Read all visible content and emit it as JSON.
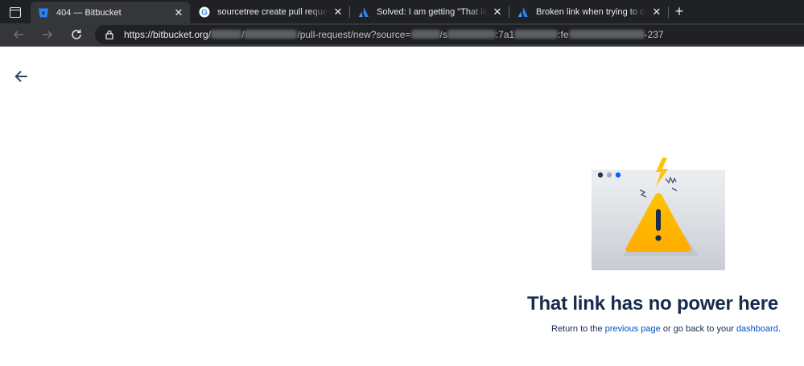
{
  "browser": {
    "tabs": [
      {
        "title": "404 — Bitbucket",
        "icon": "bitbucket-icon",
        "active": true
      },
      {
        "title": "sourcetree create pull request Th",
        "icon": "google-icon",
        "active": false
      },
      {
        "title": "Solved: I am getting \"That link ha",
        "icon": "atlassian-icon",
        "active": false
      },
      {
        "title": "Broken link when trying to create",
        "icon": "atlassian-icon",
        "active": false
      }
    ],
    "close_glyph": "✕",
    "new_tab_glyph": "+",
    "url": {
      "host": "https://bitbucket.org/",
      "seg1": "/",
      "seg2": "/pull-request/new?source=",
      "seg3": "/s",
      "seg4": ":7a1",
      "seg5": ":fe",
      "seg6": "-237"
    }
  },
  "page": {
    "heading": "That link has no power here",
    "sub_prefix": "Return to the ",
    "previous_link": "previous page",
    "sub_middle": " or go back to your ",
    "dashboard_link": "dashboard",
    "sub_suffix": "."
  },
  "colors": {
    "heading": "#172b4d",
    "link": "#0052cc",
    "warning": "#ffab00",
    "lightning": "#ffc400"
  }
}
